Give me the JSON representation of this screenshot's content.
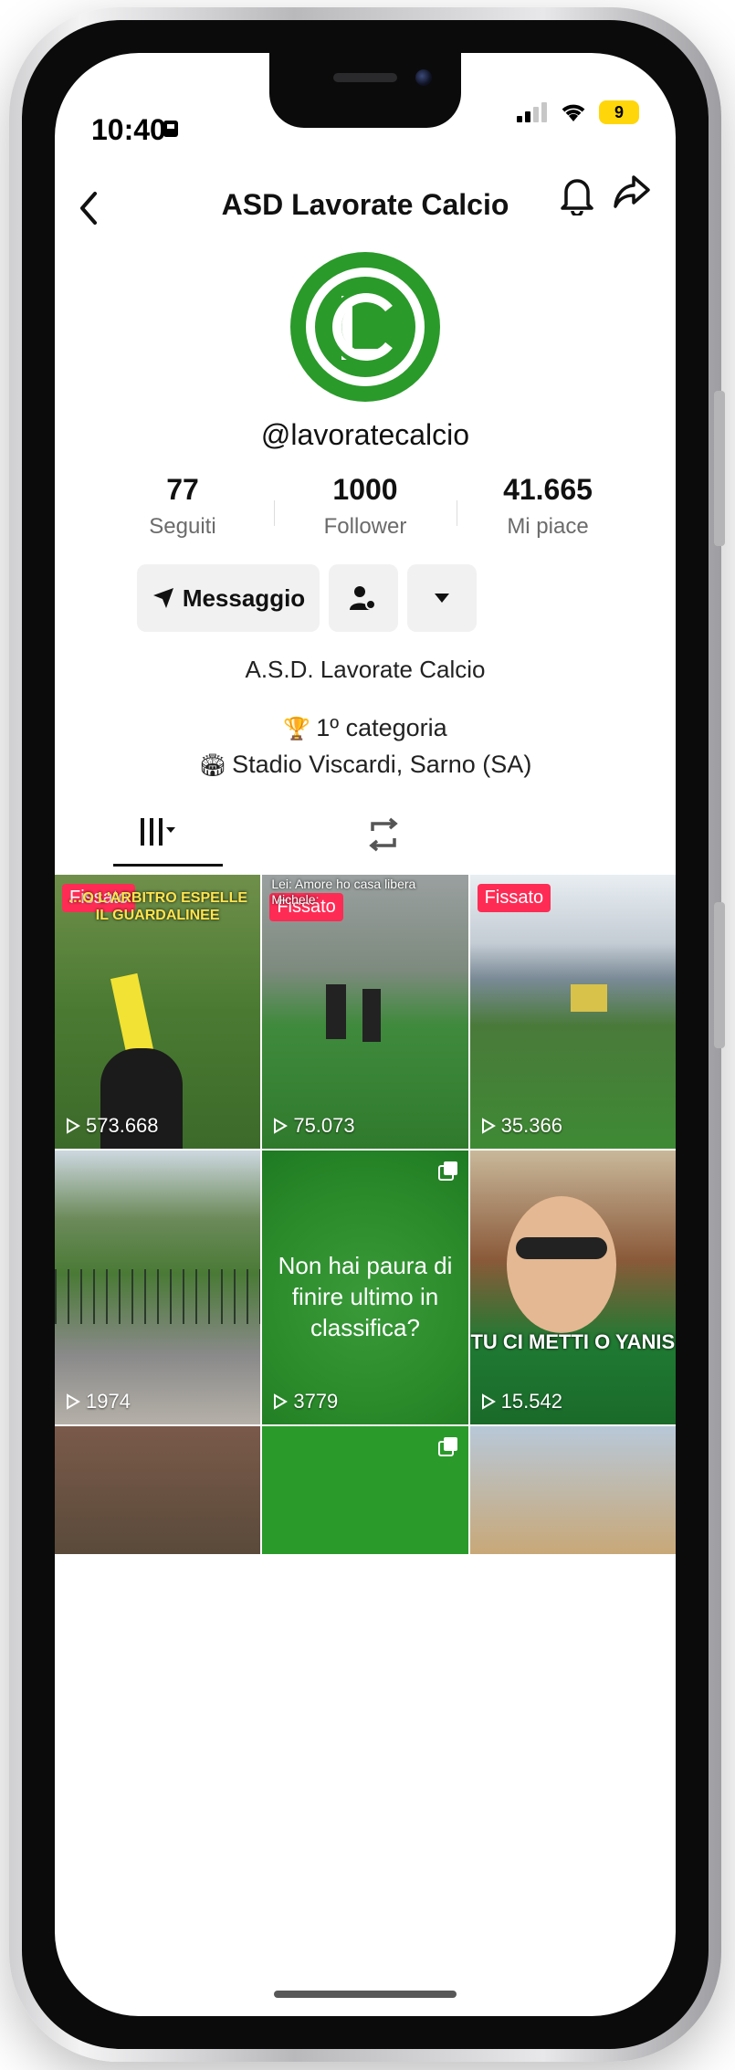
{
  "status_bar": {
    "time": "10:40",
    "battery": "9"
  },
  "header": {
    "title": "ASD Lavorate Calcio"
  },
  "profile": {
    "username": "@lavoratecalcio",
    "stats": [
      {
        "value": "77",
        "label": "Seguiti"
      },
      {
        "value": "1000",
        "label": "Follower"
      },
      {
        "value": "41.665",
        "label": "Mi piace"
      }
    ],
    "message_label": "Messaggio",
    "bio_name": "A.S.D. Lavorate Calcio",
    "bio_category": "1º categoria",
    "bio_location": "Stadio Viscardi, Sarno (SA)"
  },
  "icons": {
    "trophy": "🏆",
    "stadium": "🏟",
    "bio_trophy_icon": "trophy-icon",
    "bio_stadium_icon": "stadium-icon"
  },
  "colors": {
    "accent_red": "#fe2c55",
    "brand_green": "#2a9a2a"
  },
  "grid": [
    {
      "pinned": "Fissato",
      "caption": "…O L'ARBITRO ESPELLE IL GUARDALINEE",
      "views": "573.668"
    },
    {
      "pinned": "Fissato",
      "caption": "Lei: Amore ho casa libera Michele:",
      "views": "75.073"
    },
    {
      "pinned": "Fissato",
      "views": "35.366"
    },
    {
      "views": "1974"
    },
    {
      "text": "Non hai paura di finire ultimo in classifica?",
      "views": "3779"
    },
    {
      "caption": "TU CI METTI O YANIS",
      "views": "15.542"
    }
  ]
}
